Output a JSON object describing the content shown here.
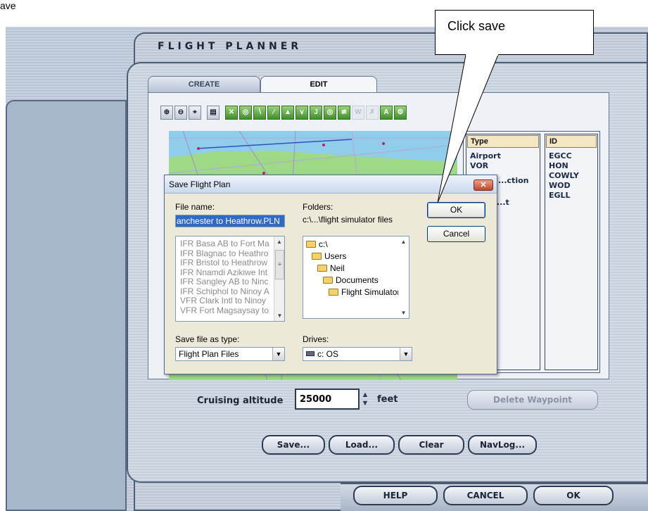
{
  "corner_label": "ave",
  "planner": {
    "title": "FLIGHT PLANNER",
    "tabs": [
      {
        "label": "CREATE"
      },
      {
        "label": "EDIT"
      }
    ],
    "toolbar": [
      "⊕",
      "⊖",
      "⌖",
      "▤",
      "✕",
      "◎",
      "∖",
      "∕",
      "▲",
      "∨",
      "J",
      "◎",
      "≇",
      "W",
      "✗",
      "A",
      "⚙"
    ],
    "waypoints": {
      "type_header": "Type",
      "id_header": "ID",
      "types": [
        "Airport",
        "VOR",
        "...ction",
        "",
        "...t"
      ],
      "ids": [
        "EGCC",
        "HON",
        "COWLY",
        "WOD",
        "EGLL"
      ]
    },
    "cruising_altitude_label": "Cruising altitude",
    "cruising_altitude_value": "25000",
    "altitude_unit": "feet",
    "delete_waypoint_label": "Delete Waypoint",
    "buttons": {
      "save": "Save...",
      "load": "Load...",
      "clear": "Clear",
      "navlog": "NavLog..."
    },
    "bottom_buttons": {
      "help": "HELP",
      "cancel": "CANCEL",
      "ok": "OK"
    }
  },
  "dialog": {
    "title": "Save Flight Plan",
    "file_name_label": "File name:",
    "file_name_value": "anchester to Heathrow.PLN",
    "files": [
      "IFR Basa AB to Fort Ma",
      "IFR Blagnac to Heathro",
      "IFR Bristol to Heathrow",
      "IFR Nnamdi Azikiwe Int",
      "IFR Sangley AB to Ninc",
      "IFR Schiphol to Ninoy A",
      "VFR Clark Intl to Ninoy",
      "VFR Fort Magsaysay to"
    ],
    "folders_label": "Folders:",
    "folders_path": "c:\\...\\flight simulator files",
    "folders": [
      "c:\\",
      "Users",
      "Neil",
      "Documents",
      "Flight Simulator Fil"
    ],
    "save_as_type_label": "Save file as type:",
    "save_as_type_value": "Flight Plan Files",
    "drives_label": "Drives:",
    "drives_value": "c: OS",
    "ok_label": "OK",
    "cancel_label": "Cancel",
    "close_glyph": "✕"
  },
  "callout": {
    "text": "Click save"
  }
}
